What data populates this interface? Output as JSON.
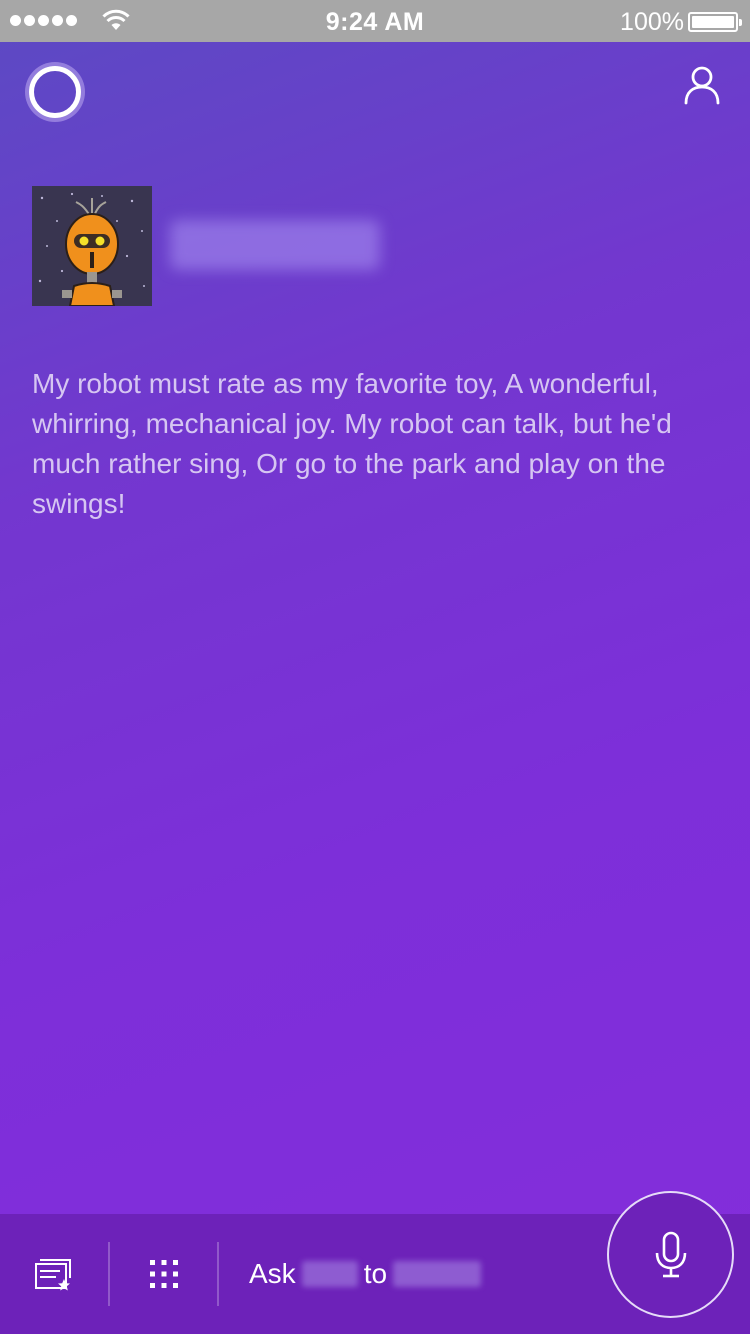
{
  "status_bar": {
    "time": "9:24 AM",
    "battery_percent": "100%",
    "signal_bars": 5
  },
  "header": {
    "assistant_icon": "cortana-ring-icon",
    "profile_icon": "profile-icon"
  },
  "card": {
    "avatar": "robot-avatar-image",
    "name": "",
    "text": "My robot must rate as my favorite toy, A wonderful, whirring, mechanical joy. My robot can talk, but he'd much rather sing, Or go to the park and play on the swings!"
  },
  "bottom_bar": {
    "notebook_icon": "notebook-icon",
    "apps_icon": "grid-icon",
    "ask_prefix": "Ask",
    "ask_middle": "to",
    "mic_icon": "microphone-icon"
  },
  "colors": {
    "background_top": "#5d49c4",
    "background_bottom": "#842ddb",
    "bottom_bar": "#6d22b9",
    "poem_text": "#d6c6f2"
  }
}
